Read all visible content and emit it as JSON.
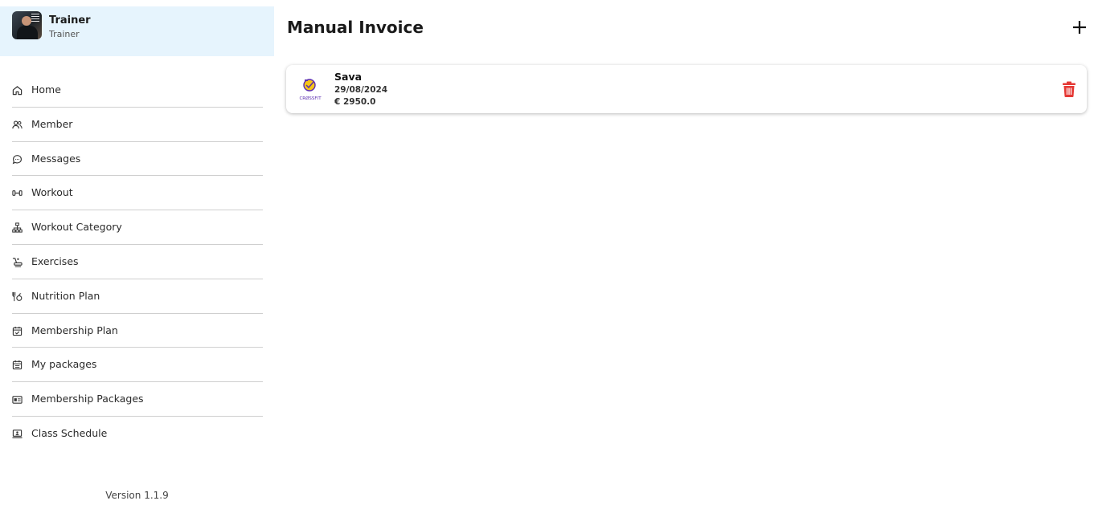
{
  "profile": {
    "name": "Trainer",
    "role": "Trainer"
  },
  "sidebar": {
    "items": [
      {
        "label": "Home",
        "icon": "home-icon"
      },
      {
        "label": "Member",
        "icon": "users-icon"
      },
      {
        "label": "Messages",
        "icon": "chat-icon"
      },
      {
        "label": "Workout",
        "icon": "dumbbell-icon"
      },
      {
        "label": "Workout Category",
        "icon": "hierarchy-icon"
      },
      {
        "label": "Exercises",
        "icon": "treadmill-icon"
      },
      {
        "label": "Nutrition Plan",
        "icon": "nutrition-icon"
      },
      {
        "label": "Membership Plan",
        "icon": "calendar-check-icon"
      },
      {
        "label": "My packages",
        "icon": "calendar-list-icon"
      },
      {
        "label": "Membership Packages",
        "icon": "card-icon"
      },
      {
        "label": "Class Schedule",
        "icon": "screen-user-icon"
      }
    ],
    "version": "Version 1.1.9"
  },
  "main": {
    "title": "Manual Invoice",
    "add_icon": "plus-icon",
    "invoices": [
      {
        "name": "Sava",
        "date": "29/08/2024",
        "amount": "€ 2950.0",
        "logo_text": "CRØSSFIT",
        "delete_icon": "trash-icon"
      }
    ]
  },
  "colors": {
    "profile_bg": "#e6f4fd",
    "delete": "#e53935",
    "logo_accent": "#f5c518",
    "logo_purple": "#5b2db0"
  }
}
